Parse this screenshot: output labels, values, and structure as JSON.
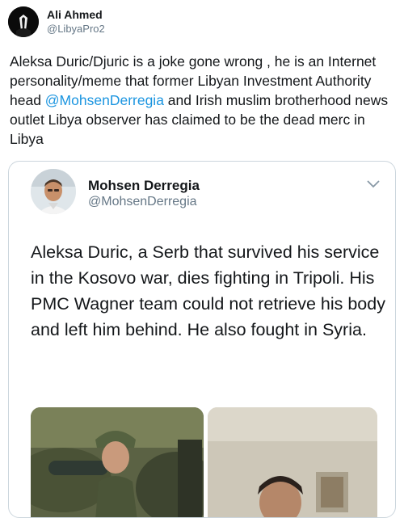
{
  "tweet": {
    "author": {
      "name": "Ali Ahmed",
      "handle": "@LibyaPro2"
    },
    "text_before": "Aleksa Duric/Djuric is a joke gone wrong , he is an Internet personality/meme that former Libyan Investment Authority head ",
    "mention": "@MohsenDerregia",
    "text_after": " and Irish muslim brotherhood news outlet Libya observer has claimed to be the dead merc in Libya"
  },
  "quoted": {
    "name": "Mohsen Derregia",
    "handle": "@MohsenDerregia",
    "text": "Aleksa Duric, a Serb that survived his service in the Kosovo war, dies fighting in Tripoli. His PMC Wagner team could not retrieve his body and left him behind. He also fought in Syria.",
    "menu_icon": "chevron-down-icon"
  },
  "colors": {
    "link": "#1b95e0",
    "border": "#ccd6dd",
    "secondary": "#657786"
  }
}
